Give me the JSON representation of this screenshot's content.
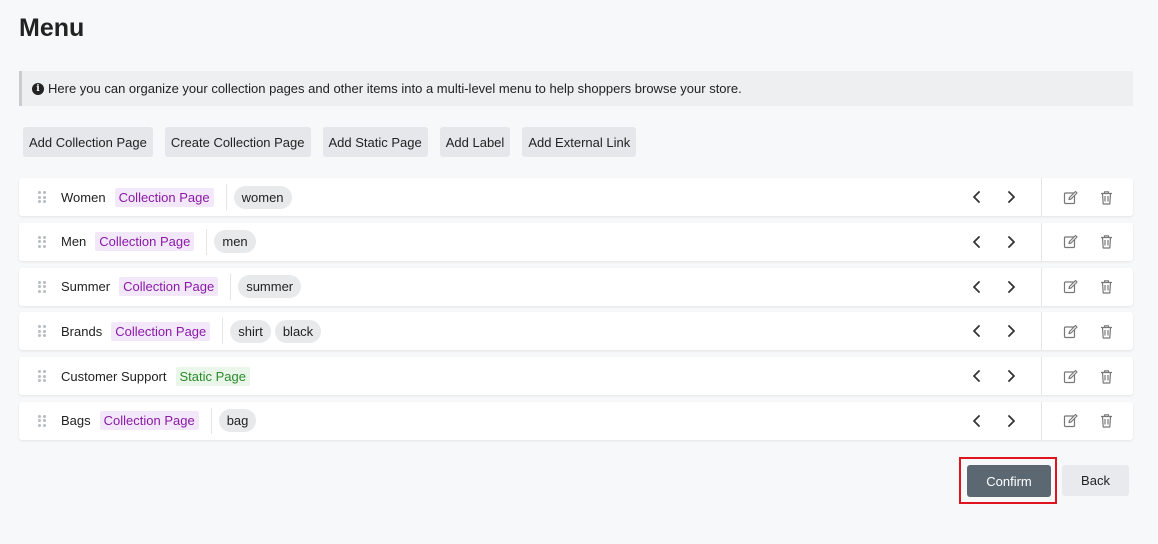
{
  "page": {
    "title": "Menu"
  },
  "info": {
    "text": "Here you can organize your collection pages and other items into a multi-level menu to help shoppers browse your store."
  },
  "toolbar": {
    "buttons": [
      {
        "label": "Add Collection Page"
      },
      {
        "label": "Create Collection Page"
      },
      {
        "label": "Add Static Page"
      },
      {
        "label": "Add Label"
      },
      {
        "label": "Add External Link"
      }
    ]
  },
  "menu_items": [
    {
      "name": "Women",
      "type": "Collection Page",
      "tags": [
        "women"
      ]
    },
    {
      "name": "Men",
      "type": "Collection Page",
      "tags": [
        "men"
      ]
    },
    {
      "name": "Summer",
      "type": "Collection Page",
      "tags": [
        "summer"
      ]
    },
    {
      "name": "Brands",
      "type": "Collection Page",
      "tags": [
        "shirt",
        "black"
      ]
    },
    {
      "name": "Customer Support",
      "type": "Static Page",
      "tags": []
    },
    {
      "name": "Bags",
      "type": "Collection Page",
      "tags": [
        "bag"
      ]
    }
  ],
  "footer": {
    "confirm_label": "Confirm",
    "back_label": "Back"
  },
  "colors": {
    "collection_badge_text": "#8a1aa8",
    "static_badge_text": "#2b8a2b",
    "confirm_bg": "#5b6872",
    "highlight_border": "#e0141e"
  },
  "icons": {
    "info": "info-circle-icon",
    "drag": "drag-handle-icon",
    "left": "chevron-left-icon",
    "right": "chevron-right-icon",
    "edit": "edit-icon",
    "delete": "trash-icon"
  }
}
